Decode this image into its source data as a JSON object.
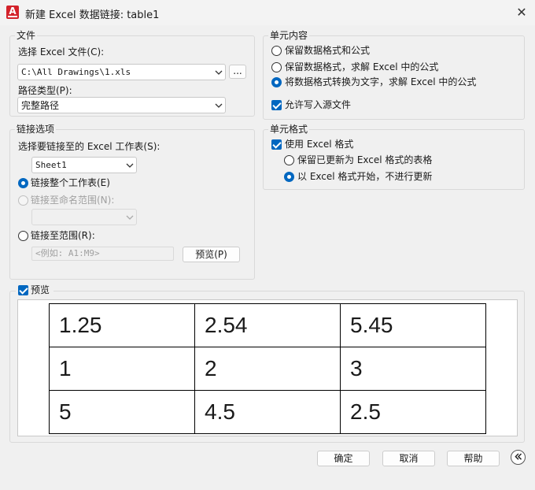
{
  "window": {
    "title": "新建 Excel 数据链接: table1",
    "icon_letter": "A",
    "close_glyph": "✕"
  },
  "file_group": {
    "title": "文件",
    "select_label": "选择 Excel 文件(C):",
    "file_value": "C:\\All Drawings\\1.xls",
    "browse_label": "...",
    "path_type_label": "路径类型(P):",
    "path_type_value": "完整路径"
  },
  "link_group": {
    "title": "链接选项",
    "sheet_label": "选择要链接至的 Excel 工作表(S):",
    "sheet_value": "Sheet1",
    "opt_entire": "链接整个工作表(E)",
    "opt_named": "链接至命名范围(N):",
    "opt_range": "链接至范围(R):",
    "range_placeholder": "<例如: A1:M9>",
    "preview_button": "预览(P)",
    "selected": "entire"
  },
  "cell_content": {
    "title": "单元内容",
    "opt1": "保留数据格式和公式",
    "opt2": "保留数据格式，求解 Excel 中的公式",
    "opt3": "将数据格式转换为文字，求解 Excel 中的公式",
    "allow_write": "允许写入源文件",
    "selected": "opt3",
    "allow_write_checked": true
  },
  "cell_format": {
    "title": "单元格式",
    "use_excel": "使用 Excel 格式",
    "use_excel_checked": true,
    "keep_updated": "保留已更新为 Excel 格式的表格",
    "start_excel": "以 Excel 格式开始，不进行更新",
    "selected": "start_excel"
  },
  "preview": {
    "label": "预览",
    "checked": true,
    "rows": [
      [
        "1.25",
        "2.54",
        "5.45"
      ],
      [
        "1",
        "2",
        "3"
      ],
      [
        "5",
        "4.5",
        "2.5"
      ]
    ]
  },
  "buttons": {
    "ok": "确定",
    "cancel": "取消",
    "help": "帮助"
  },
  "colors": {
    "accent": "#0067c0",
    "app_icon": "#d3222a",
    "background": "#f0f0f0"
  }
}
